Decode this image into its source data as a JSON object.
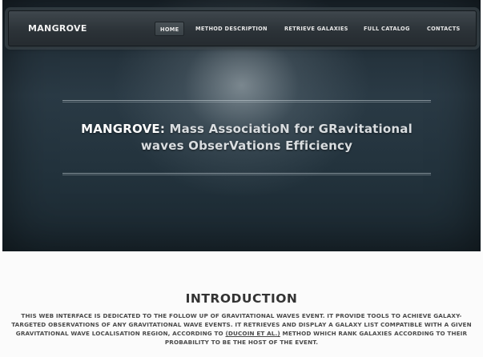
{
  "navbar": {
    "brand": "MANGROVE",
    "items": [
      {
        "label": "HOME",
        "active": true
      },
      {
        "label": "METHOD DESCRIPTION",
        "active": false
      },
      {
        "label": "RETRIEVE GALAXIES",
        "active": false
      },
      {
        "label": "FULL CATALOG",
        "active": false
      },
      {
        "label": "CONTACTS",
        "active": false
      }
    ]
  },
  "hero": {
    "title_strong": "MANGROVE:",
    "title_rest_line1": " Mass AssociatioN for GRavitational",
    "title_line2": "waves ObserVations Efficiency"
  },
  "intro": {
    "heading": "INTRODUCTION",
    "text_before_link": "THIS WEB INTERFACE IS DEDICATED TO THE FOLLOW UP OF GRAVITATIONAL WAVES EVENT. IT PROVIDE TOOLS TO ACHIEVE GALAXY-TARGETED OBSERVATIONS OF ANY GRAVITATIONAL WAVE EVENTS. IT RETRIEVES AND DISPLAY A GALAXY LIST COMPATIBLE WITH A GIVEN GRAVITATIONAL WAVE LOCALISATION REGION, ACCORDING TO ",
    "link_text": "(DUCOIN ET AL.)",
    "text_after_link": " METHOD WHICH RANK GALAXIES ACCORDING TO THEIR PROBABILITY TO BE THE HOST OF THE EVENT."
  },
  "colors": {
    "hero_dark": "#22323c",
    "navbar": "#2c3338",
    "page_bg": "#fbfbfb",
    "heading": "#333333"
  }
}
